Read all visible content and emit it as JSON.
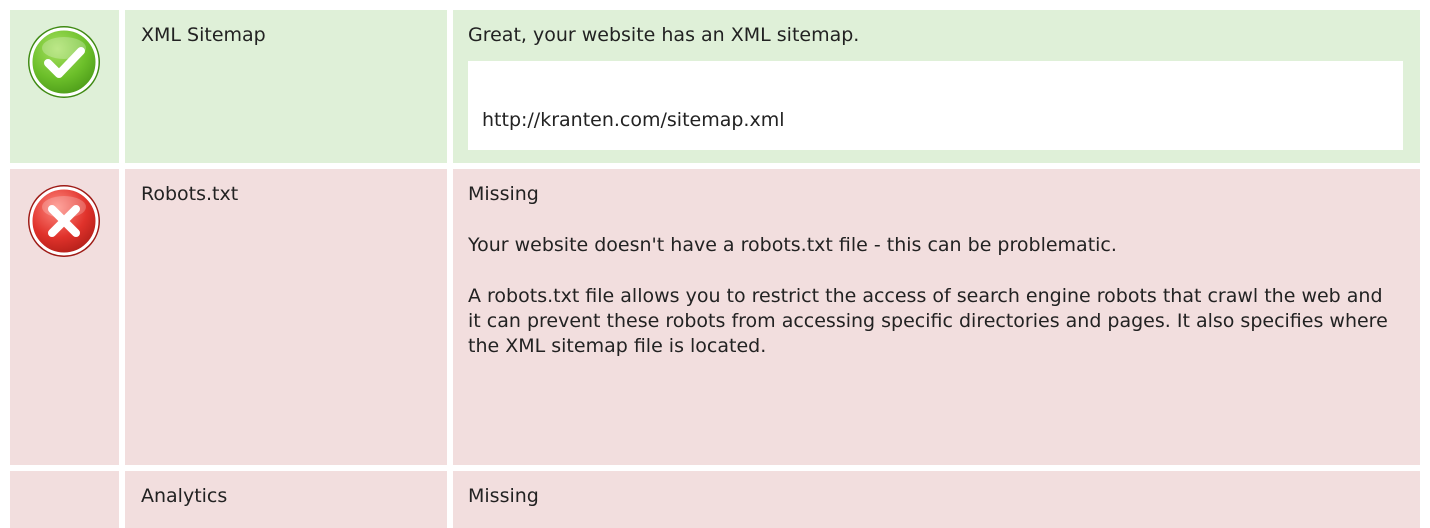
{
  "rows": [
    {
      "status": "pass",
      "status_icon": "check-circle-icon",
      "label": "XML Sitemap",
      "message": "Great, your website has an XML sitemap.",
      "url": "http://kranten.com/sitemap.xml"
    },
    {
      "status": "fail",
      "status_icon": "cross-circle-icon",
      "label": "Robots.txt",
      "message": "Missing",
      "detail": "Your website doesn't have a robots.txt file - this can be problematic.",
      "description": "A robots.txt file allows you to restrict the access of search engine robots that crawl the web and it can prevent these robots from accessing specific directories and pages. It also specifies where the XML sitemap file is located."
    },
    {
      "status": "fail",
      "label": "Analytics",
      "message": "Missing"
    }
  ],
  "colors": {
    "pass_bg": "#dff0d8",
    "fail_bg": "#f2dede",
    "pass_icon": "#6cbf2a",
    "fail_icon": "#e0322b"
  }
}
